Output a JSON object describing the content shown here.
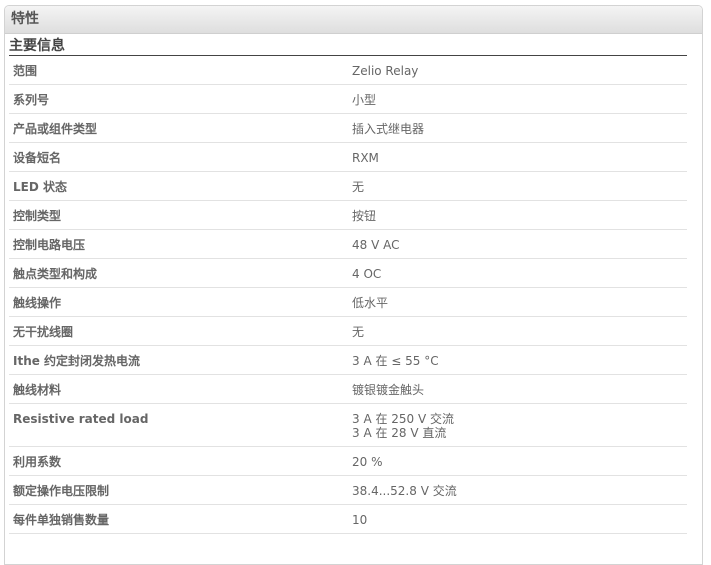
{
  "panel": {
    "title": "特性"
  },
  "section": {
    "title": "主要信息"
  },
  "rows": [
    {
      "label": "范围",
      "values": [
        "Zelio Relay"
      ]
    },
    {
      "label": "系列号",
      "values": [
        "小型"
      ]
    },
    {
      "label": "产品或组件类型",
      "values": [
        "插入式继电器"
      ]
    },
    {
      "label": "设备短名",
      "values": [
        "RXM"
      ]
    },
    {
      "label": "LED 状态",
      "values": [
        "无"
      ]
    },
    {
      "label": "控制类型",
      "values": [
        "按钮"
      ]
    },
    {
      "label": "控制电路电压",
      "values": [
        "48 V AC"
      ]
    },
    {
      "label": "触点类型和构成",
      "values": [
        "4 OC"
      ]
    },
    {
      "label": "触线操作",
      "values": [
        "低水平"
      ]
    },
    {
      "label": "无干扰线圈",
      "values": [
        "无"
      ]
    },
    {
      "label": "Ithe 约定封闭发热电流",
      "values": [
        "3 A 在 ≤ 55 °C"
      ]
    },
    {
      "label": "触线材料",
      "values": [
        "镀银镀金触头"
      ]
    },
    {
      "label": "Resistive rated load",
      "values": [
        "3 A 在 250 V 交流",
        "3 A 在 28 V 直流"
      ]
    },
    {
      "label": "利用系数",
      "values": [
        "20 %"
      ]
    },
    {
      "label": "额定操作电压限制",
      "values": [
        "38.4...52.8 V 交流"
      ]
    },
    {
      "label": "每件单独销售数量",
      "values": [
        "10"
      ]
    }
  ]
}
